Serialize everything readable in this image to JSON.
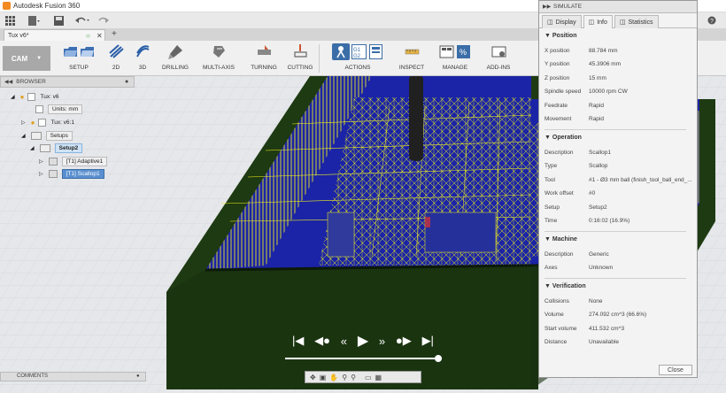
{
  "app": {
    "title": "Autodesk Fusion 360"
  },
  "document_tab": {
    "label": "Tux v6*"
  },
  "workspace": {
    "label": "CAM"
  },
  "ribbon_groups": {
    "setup": "SETUP",
    "two_d": "2D",
    "three_d": "3D",
    "drilling": "DRILLING",
    "multi_axis": "MULTI-AXIS",
    "turning": "TURNING",
    "cutting": "CUTTING",
    "actions": "ACTIONS",
    "inspect": "INSPECT",
    "manage": "MANAGE",
    "add_ins": "ADD-INS"
  },
  "browser": {
    "title": "BROWSER",
    "items": {
      "root": "Tux: v6",
      "units": "Units: mm",
      "component": "Tux: v6:1",
      "setups": "Setups",
      "setup2": "Setup2",
      "op1": "[T1] Adaptive1",
      "op2": "[T1] Scallop1"
    }
  },
  "comments": {
    "label": "COMMENTS"
  },
  "simulate": {
    "title": "SIMULATE",
    "tabs": {
      "display": "Display",
      "info": "Info",
      "statistics": "Statistics"
    },
    "position": {
      "heading": "Position",
      "x_label": "X position",
      "x_value": "88.784 mm",
      "y_label": "Y position",
      "y_value": "45.3906 mm",
      "z_label": "Z position",
      "z_value": "15 mm",
      "spindle_label": "Spindle speed",
      "spindle_value": "10000 rpm CW",
      "feed_label": "Feedrate",
      "feed_value": "Rapid",
      "move_label": "Movement",
      "move_value": "Rapid"
    },
    "operation": {
      "heading": "Operation",
      "desc_label": "Description",
      "desc_value": "Scallop1",
      "type_label": "Type",
      "type_value": "Scallop",
      "tool_label": "Tool",
      "tool_value": "#1 - Ø3 mm ball (finish_tool_ball_end_...",
      "wo_label": "Work offset",
      "wo_value": "#0",
      "setup_label": "Setup",
      "setup_value": "Setup2",
      "time_label": "Time",
      "time_value": "0:16:02 (16.9%)"
    },
    "machine": {
      "heading": "Machine",
      "desc_label": "Description",
      "desc_value": "Generic",
      "axes_label": "Axes",
      "axes_value": "Unknown"
    },
    "verification": {
      "heading": "Verification",
      "coll_label": "Collisions",
      "coll_value": "None",
      "vol_label": "Volume",
      "vol_value": "274.092 cm^3 (66.6%)",
      "svol_label": "Start volume",
      "svol_value": "411.532 cm^3",
      "dist_label": "Distance",
      "dist_value": "Unavailable"
    },
    "close_label": "Close"
  },
  "playback": {
    "progress_percent": 98
  },
  "colors": {
    "stock": "#1e3a12",
    "toolpath": "#f0f000",
    "material": "#1a23a8",
    "tool": "#202020"
  }
}
